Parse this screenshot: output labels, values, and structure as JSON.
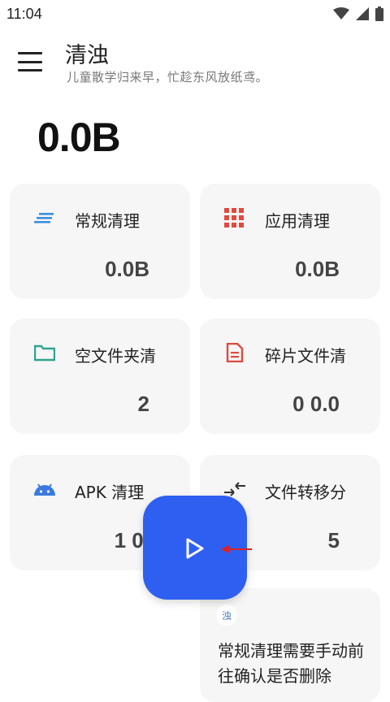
{
  "status_bar": {
    "time": "11:04"
  },
  "app": {
    "title": "清浊",
    "subtitle": "儿童散学归来早，忙趁东风放纸鸢。"
  },
  "total": {
    "size": "0.0B"
  },
  "cards": [
    {
      "label": "常规清理",
      "value": "0.0B",
      "icon": "lines-icon",
      "color": "#3b8fdc"
    },
    {
      "label": "应用清理",
      "value": "0.0B",
      "icon": "grid-icon",
      "color": "#e04a3f"
    },
    {
      "label": "空文件夹清",
      "value": "2",
      "icon": "folder-icon",
      "color": "#2fa38f"
    },
    {
      "label": "碎片文件清",
      "value": "0 0.0",
      "icon": "document-icon",
      "color": "#e04a3f"
    },
    {
      "label": "APK 清理",
      "value": "1 0.",
      "icon": "android-icon",
      "color": "#3a7ae0"
    },
    {
      "label": "文件转移分",
      "value": "5",
      "icon": "transfer-arrows-icon",
      "color": "#333333"
    }
  ],
  "tip": {
    "logo_text": "浊",
    "text": "常规清理需要手动前往确认是否删除"
  },
  "fab": {
    "icon": "play-icon",
    "color": "#2f5ff0"
  },
  "annotation": {
    "icon": "red-arrow-icon",
    "color": "#e02020"
  }
}
